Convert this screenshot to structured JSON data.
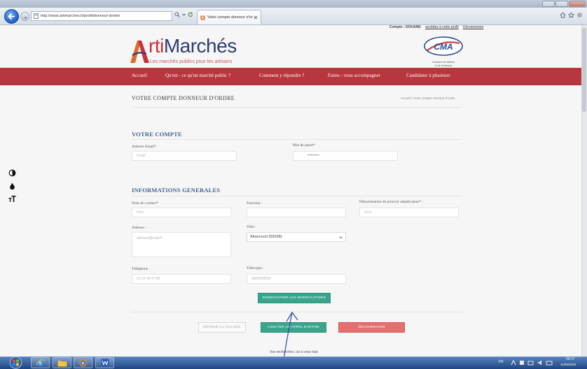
{
  "browser": {
    "url": "http://www.artimarches.fr/profil/donneur-dordre",
    "tab_title": "Votre compte donneur d'or..."
  },
  "header": {
    "account": {
      "label": "Compte : DOUANE",
      "profile_link": "accédez à votre profil",
      "logout_link": "Déconnexion"
    },
    "logo": {
      "initial": "A",
      "rti": "rti",
      "marches": "Marchés",
      "tagline": "Les marchés publics pour les artisans"
    },
    "partner_logo": {
      "mark": "CMA",
      "lines": [
        "Chambre de Métiers",
        "et de l'Artisanat"
      ]
    }
  },
  "nav": {
    "items": [
      "Accueil",
      "Qu'est - ce qu'un marché public ?",
      "Comment y répondre ?",
      "Faites - vous accompagner",
      "Candidater à plusieurs"
    ]
  },
  "page": {
    "title": "VOTRE COMPTE DONNEUR D'ORDRE",
    "breadcrumb": "Accueil / Votre compte donneur d'ordre"
  },
  "account": {
    "heading": "VOTRE COMPTE",
    "email": {
      "label": "Adresse Email*",
      "placeholder": "Email"
    },
    "password": {
      "label": "Mot de passe*",
      "value": "••••••••"
    }
  },
  "general": {
    "heading": "INFORMATIONS GENERALES",
    "contact_name": {
      "label": "Nom du contact*",
      "placeholder": "Nom"
    },
    "function": {
      "label": "Fonction :"
    },
    "authority": {
      "label": "Dénomination du pouvoir adjudicateur* :",
      "placeholder": "Nom"
    },
    "address": {
      "label": "Adresse :",
      "value": "adresse@mail.fr"
    },
    "city": {
      "label": "Ville :",
      "selected": "Abancourt (59268)"
    },
    "phone": {
      "label": "Téléphone :",
      "value": "01 23 45 67 89"
    },
    "fax": {
      "label": "Télécopie :",
      "value": "0000000000"
    }
  },
  "actions": {
    "save": "ENREGISTRER LES MODIFICATIONS",
    "back_home": "RETOUR À L'ACCUEIL",
    "add_tender": "AJOUTER UN APPEL D'OFFRE",
    "logout": "DÉCONNEXION"
  },
  "footer": {
    "text": "Vos recherches, où à vous tout"
  },
  "taskbar": {
    "apps": [
      "start-orb-icon",
      "internet-explorer-icon",
      "folder-icon",
      "media-player-icon",
      "word-icon"
    ],
    "tray": {
      "lang": "FR",
      "time": "09:17",
      "date": "11/05/2016"
    }
  },
  "icons": {
    "accessibility": [
      "contrast-icon",
      "drop-icon",
      "text-size-icon"
    ],
    "browser": [
      "back-arrow-icon",
      "forward-arrow-icon",
      "search-icon",
      "refresh-icon",
      "home-icon",
      "star-icon",
      "gear-icon"
    ]
  },
  "colors": {
    "nav": "#b8363d",
    "accent": "#3aa48c",
    "danger": "#e56f6e",
    "heading": "#3f6390",
    "logo_red": "#c8323a",
    "logo_blue": "#2e3d73",
    "annotation": "#2a4f9e"
  }
}
